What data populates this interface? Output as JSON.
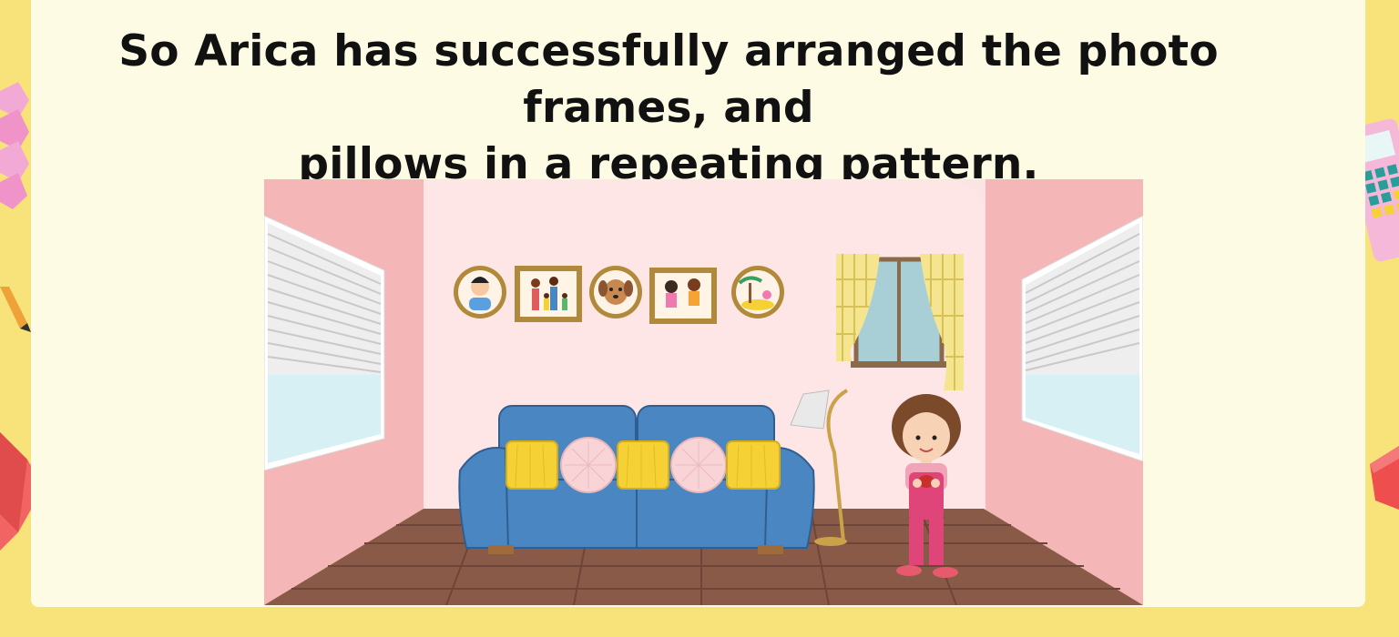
{
  "slide": {
    "heading_line_1": "So Arica has successfully arranged the photo frames, and",
    "heading_line_2": "pillows in a repeating pattern."
  },
  "scene": {
    "character": "Arica",
    "wall_frames": [
      "boy-round-frame",
      "family-square-frame",
      "puppy-round-frame",
      "kids-square-frame",
      "beach-round-frame"
    ],
    "sofa_pillows": [
      "yellow-square-pillow",
      "pink-round-pillow",
      "yellow-square-pillow",
      "pink-round-pillow",
      "yellow-square-pillow"
    ]
  },
  "colors": {
    "page_background": "#f8e27a",
    "card_background": "#fdfbe3",
    "wall": "#fde4e4",
    "side_wall": "#f4b6b6",
    "sofa": "#4a86c2",
    "floor": "#8a5a48",
    "pillow_yellow": "#f5d136",
    "pillow_pink": "#f9d4d6",
    "frame_gold": "#b08a3a"
  }
}
